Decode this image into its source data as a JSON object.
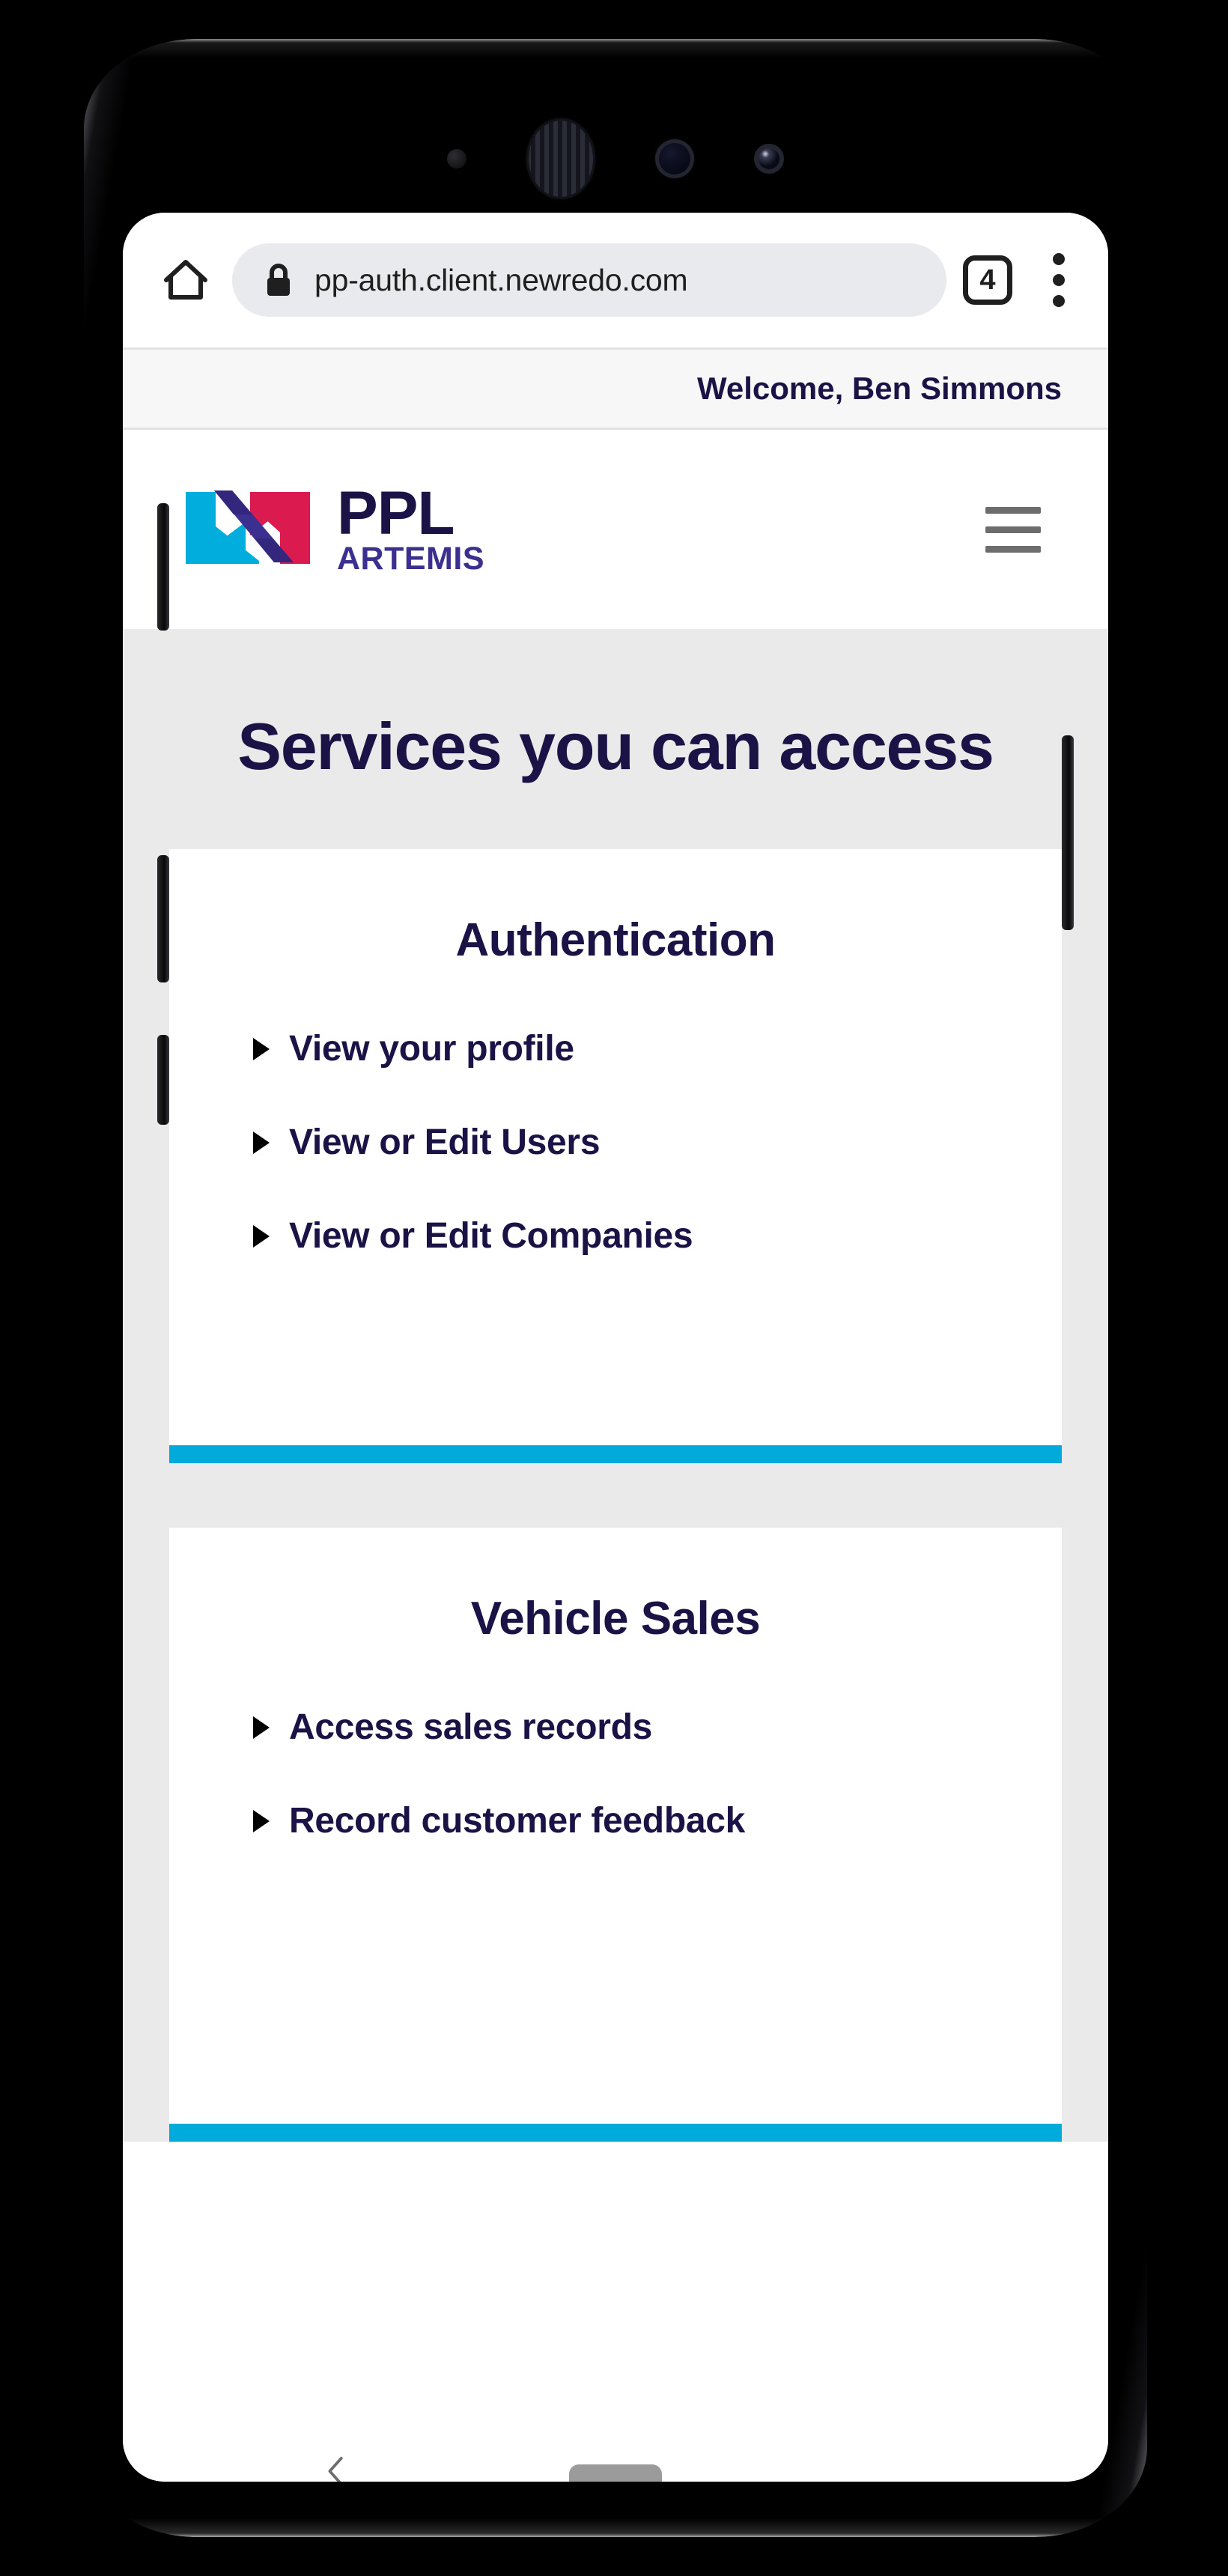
{
  "device": {
    "sensors": [
      "proximity-sensor",
      "earpiece-speaker",
      "front-camera",
      "iris-scanner"
    ]
  },
  "browser": {
    "home_icon": "home-icon",
    "lock_icon": "lock-icon",
    "url": "pp-auth.client.newredo.com",
    "tab_count": "4",
    "overflow_icon": "more-vertical-icon"
  },
  "welcome": {
    "text": "Welcome, Ben Simmons"
  },
  "site_header": {
    "logo_mark": "ppl-artemis-ribbon-logo",
    "wordmark_primary": "PPL",
    "wordmark_secondary": "ARTEMIS",
    "menu_icon": "hamburger-menu-icon"
  },
  "page": {
    "title": "Services you can access",
    "background": "#eaeaea"
  },
  "cards": [
    {
      "title": "Authentication",
      "accent_color": "#00ABDB",
      "links": [
        "View your profile",
        "View or Edit Users",
        "View or Edit Companies"
      ]
    },
    {
      "title": "Vehicle Sales",
      "accent_color": "#00ABDB",
      "links": [
        "Access sales records",
        "Record customer feedback"
      ]
    }
  ],
  "colors": {
    "navy": "#1b1346",
    "purple": "#3b2f8f",
    "cyan": "#00ABDB",
    "crimson": "#DB1A4F",
    "page_bg": "#eaeaea",
    "card_bg": "#ffffff",
    "omnibox_bg": "#e9eaee"
  },
  "android_nav": {
    "back_icon": "chevron-left-icon",
    "home_icon": "home-pill-icon"
  }
}
